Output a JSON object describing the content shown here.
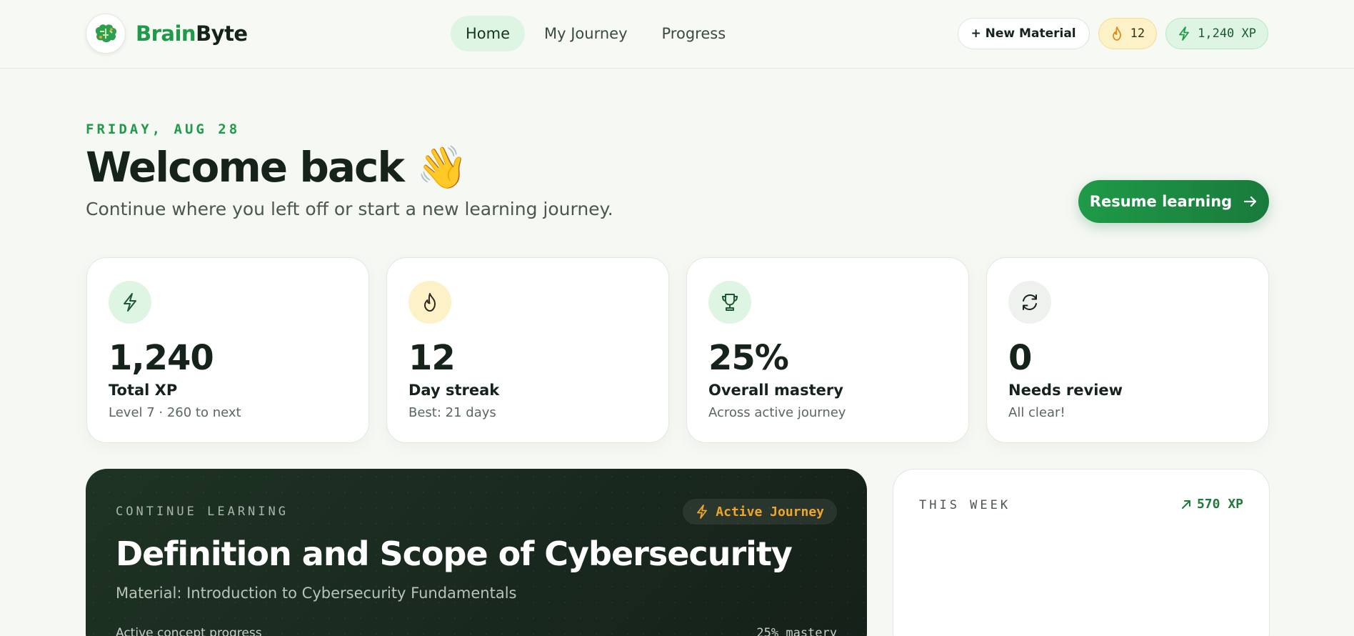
{
  "brand": {
    "name_part1": "Brain",
    "name_part2": "Byte",
    "logo_icon": "brain-icon"
  },
  "nav": {
    "items": [
      {
        "label": "Home",
        "active": true
      },
      {
        "label": "My Journey",
        "active": false
      },
      {
        "label": "Progress",
        "active": false
      }
    ]
  },
  "top_actions": {
    "new_material": "+ New Material",
    "streak_count": "12",
    "xp_total": "1,240 XP"
  },
  "header": {
    "date": "FRIDAY, AUG 28",
    "welcome": "Welcome back 👋",
    "subtitle": "Continue where you left off or start a new learning journey.",
    "resume_label": "Resume learning"
  },
  "stats": [
    {
      "icon": "lightning-icon",
      "value": "1,240",
      "label": "Total XP",
      "sub": "Level 7 · 260 to next",
      "icon_bg": "#dff5e4"
    },
    {
      "icon": "flame-icon",
      "value": "12",
      "label": "Day streak",
      "sub": "Best: 21 days",
      "icon_bg": "#fdf1c7"
    },
    {
      "icon": "trophy-icon",
      "value": "25%",
      "label": "Overall mastery",
      "sub": "Across active journey",
      "icon_bg": "#dff5e4"
    },
    {
      "icon": "refresh-icon",
      "value": "0",
      "label": "Needs review",
      "sub": "All clear!",
      "icon_bg": "#eef1ed"
    }
  ],
  "continue_learning": {
    "eyebrow": "CONTINUE LEARNING",
    "badge": "Active Journey",
    "title": "Definition and Scope of Cybersecurity",
    "material": "Material: Introduction to Cybersecurity Fundamentals",
    "progress_label": "Active concept progress",
    "progress_value": "25% mastery"
  },
  "this_week": {
    "title": "THIS WEEK",
    "xp": "570 XP"
  },
  "colors": {
    "accent": "#1f9a48",
    "background": "#f6f8f4",
    "dark_card": "#17231b",
    "badge_orange": "#f0a62a"
  }
}
